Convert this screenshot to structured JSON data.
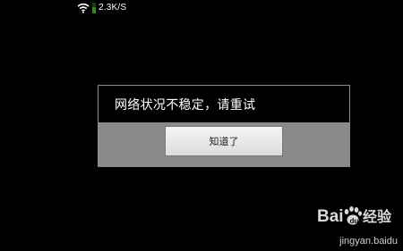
{
  "status_bar": {
    "wifi_icon": "wifi-icon",
    "signal_icon": "signal-strength-icon",
    "net_speed": "2.3K/S",
    "signal_level": 0.55
  },
  "dialog": {
    "message": "网络状况不稳定，请重试",
    "button_label": "知道了"
  },
  "watermark": {
    "logo_text": "Bai du 经验",
    "domain": "jingyan.baidu"
  },
  "colors": {
    "background": "#000000",
    "dialog_button_area": "#8a8a8a",
    "signal": "#2f8a1e"
  }
}
